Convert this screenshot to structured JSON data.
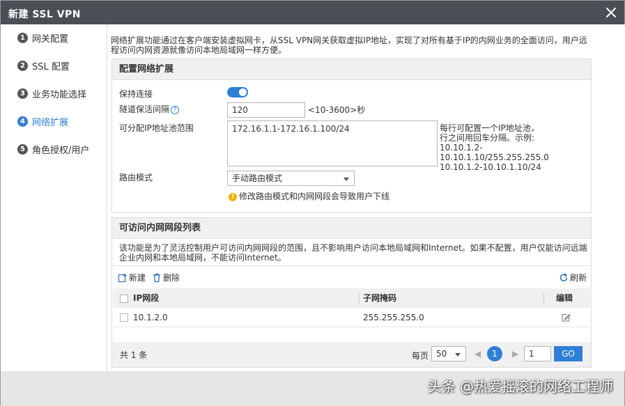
{
  "dialog": {
    "title": "新建 SSL VPN"
  },
  "steps": [
    {
      "num": "1",
      "label": "网关配置"
    },
    {
      "num": "2",
      "label": "SSL 配置"
    },
    {
      "num": "3",
      "label": "业务功能选择"
    },
    {
      "num": "4",
      "label": "网络扩展"
    },
    {
      "num": "5",
      "label": "角色授权/用户"
    }
  ],
  "description": "网络扩展功能通过在客户端安装虚拟网卡，从SSL VPN网关获取虚拟IP地址，实现了对所有基于IP的内网业务的全面访问，用户远程访问内网资源就像访问本地局域网一样方便。",
  "config_panel": {
    "title": "配置网络扩展",
    "keep_alive_label": "保持连接",
    "keep_alive_on": true,
    "tunnel_interval_label": "隧道保活间隔",
    "tunnel_interval_value": "120",
    "tunnel_interval_hint": "<10-3600>秒",
    "ip_pool_label": "可分配IP地址池范围",
    "ip_pool_value": "172.16.1.1-172.16.1.100/24",
    "ip_pool_hint_1": "每行可配置一个IP地址池，",
    "ip_pool_hint_2": "行之间用回车分隔。示例:",
    "ip_pool_hint_3": "10.10.1.2-10.10.1.10/255.255.255.0",
    "ip_pool_hint_4": "10.10.1.2-10.10.1.10/24",
    "route_mode_label": "路由模式",
    "route_mode_value": "手动路由模式",
    "route_warning": "修改路由模式和内网网段会导致用户下线"
  },
  "list_panel": {
    "title": "可访问内网网段列表",
    "description": "该功能是为了灵活控制用户可访问内网网段的范围，且不影响用户访问本地局域网和Internet。如果不配置，用户仅能访问远端企业内网和本地局域网，不能访问Internet。",
    "new_label": "新建",
    "delete_label": "删除",
    "refresh_label": "刷新",
    "columns": {
      "ip": "IP网段",
      "mask": "子网掩码",
      "edit": "编辑"
    },
    "rows": [
      {
        "ip": "10.1.2.0",
        "mask": "255.255.255.0"
      }
    ],
    "total": "共 1 条",
    "per_page_label": "每页",
    "per_page_value": "50",
    "current_page": "1",
    "page_input": "1",
    "go_label": "GO"
  },
  "watermark": "头条 @热爱摇滚的网络工程师",
  "colors": {
    "accent": "#2f7fd6",
    "titlebar": "#4a4e55",
    "warning": "#f0b400"
  }
}
